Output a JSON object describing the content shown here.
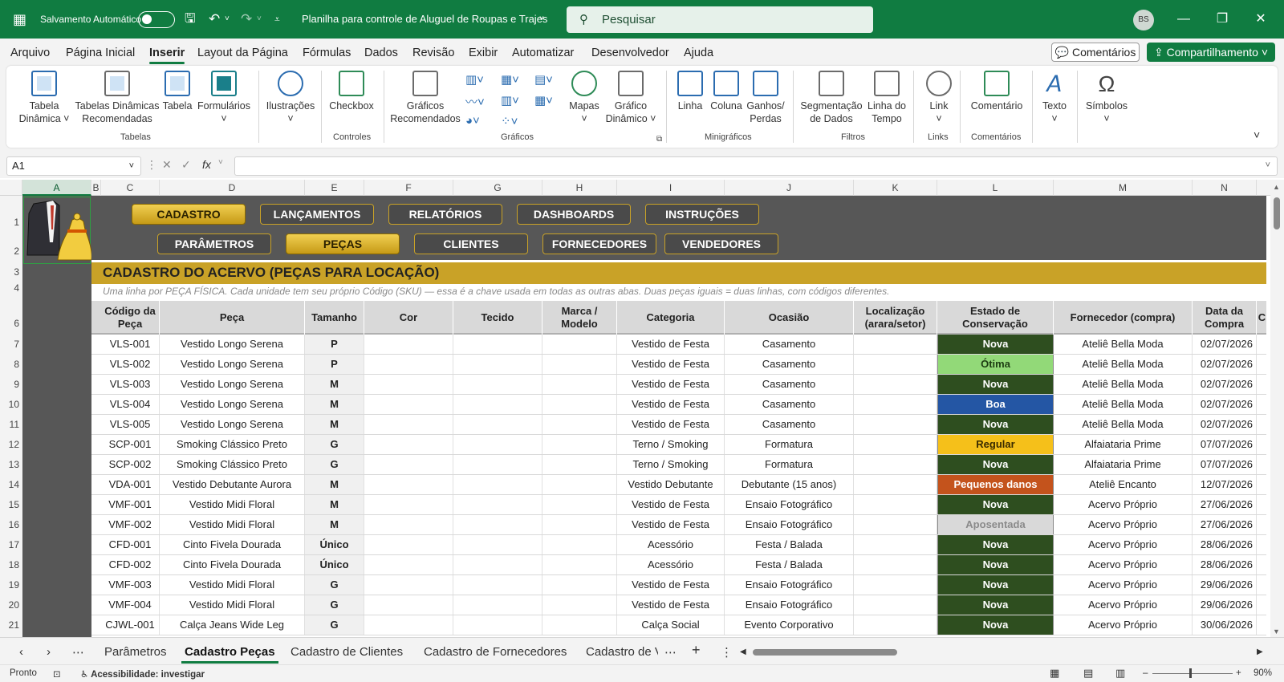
{
  "titlebar": {
    "autosave_label": "Salvamento Automático",
    "doc_title": "Planilha para controle de Aluguel de Roupas e Trajes",
    "search_placeholder": "Pesquisar",
    "user_initials": "BS"
  },
  "menu": {
    "items": [
      "Arquivo",
      "Página Inicial",
      "Inserir",
      "Layout da Página",
      "Fórmulas",
      "Dados",
      "Revisão",
      "Exibir",
      "Automatizar",
      "Desenvolvedor",
      "Ajuda"
    ],
    "active": "Inserir",
    "comments_label": "Comentários",
    "share_label": "Compartilhamento"
  },
  "ribbon": {
    "buttons": [
      {
        "label1": "Tabela",
        "label2": "Dinâmica ˅"
      },
      {
        "label1": "Tabelas Dinâmicas",
        "label2": "Recomendadas"
      },
      {
        "label1": "Tabela",
        "label2": ""
      },
      {
        "label1": "Formulários",
        "label2": "˅"
      },
      {
        "label1": "Ilustrações",
        "label2": "˅"
      },
      {
        "label1": "Checkbox",
        "label2": ""
      },
      {
        "label1": "Gráficos",
        "label2": "Recomendados"
      },
      {
        "label1": "Mapas",
        "label2": "˅"
      },
      {
        "label1": "Gráfico",
        "label2": "Dinâmico ˅"
      },
      {
        "label1": "Linha",
        "label2": ""
      },
      {
        "label1": "Coluna",
        "label2": ""
      },
      {
        "label1": "Ganhos/",
        "label2": "Perdas"
      },
      {
        "label1": "Segmentação",
        "label2": "de Dados"
      },
      {
        "label1": "Linha do",
        "label2": "Tempo"
      },
      {
        "label1": "Link",
        "label2": "˅"
      },
      {
        "label1": "Comentário",
        "label2": ""
      },
      {
        "label1": "Texto",
        "label2": "˅"
      },
      {
        "label1": "Símbolos",
        "label2": "˅"
      }
    ],
    "groups": [
      "Tabelas",
      "Controles",
      "Gráficos",
      "Minigráficos",
      "Filtros",
      "Links",
      "Comentários"
    ]
  },
  "formula_bar": {
    "cell_ref": "A1",
    "fx": "fx"
  },
  "columns": [
    "A",
    "B",
    "C",
    "D",
    "E",
    "F",
    "G",
    "H",
    "I",
    "J",
    "K",
    "L",
    "M",
    "N"
  ],
  "row_numbers": [
    "1",
    "2",
    "3",
    "4",
    "6",
    "7",
    "8",
    "9",
    "10",
    "11",
    "12",
    "13",
    "14",
    "15",
    "16",
    "17",
    "18",
    "19",
    "20",
    "21"
  ],
  "nav": {
    "row1": [
      "CADASTRO",
      "LANÇAMENTOS",
      "RELATÓRIOS",
      "DASHBOARDS",
      "INSTRUÇÕES"
    ],
    "row2": [
      "PARÂMETROS",
      "PEÇAS",
      "CLIENTES",
      "FORNECEDORES",
      "VENDEDORES"
    ]
  },
  "sheet": {
    "banner": "CADASTRO DO ACERVO (PEÇAS PARA LOCAÇÃO)",
    "subtitle": "Uma linha por PEÇA FÍSICA. Cada unidade tem seu próprio Código (SKU) — essa é a chave usada em todas as outras abas. Duas peças iguais = duas linhas, com códigos diferentes.",
    "headers": [
      "Código da Peça",
      "Peça",
      "Tamanho",
      "Cor",
      "Tecido",
      "Marca / Modelo",
      "Categoria",
      "Ocasião",
      "Localização (arara/setor)",
      "Estado de Conservação",
      "Fornecedor (compra)",
      "Data da Compra",
      "C"
    ],
    "rows": [
      [
        "VLS-001",
        "Vestido Longo Serena",
        "P",
        "",
        "",
        "",
        "Vestido de Festa",
        "Casamento",
        "",
        "Nova",
        "Ateliê Bella Moda",
        "02/07/2026"
      ],
      [
        "VLS-002",
        "Vestido Longo Serena",
        "P",
        "",
        "",
        "",
        "Vestido de Festa",
        "Casamento",
        "",
        "Ótima",
        "Ateliê Bella Moda",
        "02/07/2026"
      ],
      [
        "VLS-003",
        "Vestido Longo Serena",
        "M",
        "",
        "",
        "",
        "Vestido de Festa",
        "Casamento",
        "",
        "Nova",
        "Ateliê Bella Moda",
        "02/07/2026"
      ],
      [
        "VLS-004",
        "Vestido Longo Serena",
        "M",
        "",
        "",
        "",
        "Vestido de Festa",
        "Casamento",
        "",
        "Boa",
        "Ateliê Bella Moda",
        "02/07/2026"
      ],
      [
        "VLS-005",
        "Vestido Longo Serena",
        "M",
        "",
        "",
        "",
        "Vestido de Festa",
        "Casamento",
        "",
        "Nova",
        "Ateliê Bella Moda",
        "02/07/2026"
      ],
      [
        "SCP-001",
        "Smoking Clássico Preto",
        "G",
        "",
        "",
        "",
        "Terno / Smoking",
        "Formatura",
        "",
        "Regular",
        "Alfaiataria Prime",
        "07/07/2026"
      ],
      [
        "SCP-002",
        "Smoking Clássico Preto",
        "G",
        "",
        "",
        "",
        "Terno / Smoking",
        "Formatura",
        "",
        "Nova",
        "Alfaiataria Prime",
        "07/07/2026"
      ],
      [
        "VDA-001",
        "Vestido Debutante Aurora",
        "M",
        "",
        "",
        "",
        "Vestido Debutante",
        "Debutante (15 anos)",
        "",
        "Pequenos danos",
        "Ateliê Encanto",
        "12/07/2026"
      ],
      [
        "VMF-001",
        "Vestido Midi Floral",
        "M",
        "",
        "",
        "",
        "Vestido de Festa",
        "Ensaio Fotográfico",
        "",
        "Nova",
        "Acervo Próprio",
        "27/06/2026"
      ],
      [
        "VMF-002",
        "Vestido Midi Floral",
        "M",
        "",
        "",
        "",
        "Vestido de Festa",
        "Ensaio Fotográfico",
        "",
        "Aposentada",
        "Acervo Próprio",
        "27/06/2026"
      ],
      [
        "CFD-001",
        "Cinto Fivela Dourada",
        "Único",
        "",
        "",
        "",
        "Acessório",
        "Festa / Balada",
        "",
        "Nova",
        "Acervo Próprio",
        "28/06/2026"
      ],
      [
        "CFD-002",
        "Cinto Fivela Dourada",
        "Único",
        "",
        "",
        "",
        "Acessório",
        "Festa / Balada",
        "",
        "Nova",
        "Acervo Próprio",
        "28/06/2026"
      ],
      [
        "VMF-003",
        "Vestido Midi Floral",
        "G",
        "",
        "",
        "",
        "Vestido de Festa",
        "Ensaio Fotográfico",
        "",
        "Nova",
        "Acervo Próprio",
        "29/06/2026"
      ],
      [
        "VMF-004",
        "Vestido Midi Floral",
        "G",
        "",
        "",
        "",
        "Vestido de Festa",
        "Ensaio Fotográfico",
        "",
        "Nova",
        "Acervo Próprio",
        "29/06/2026"
      ],
      [
        "CJWL-001",
        "Calça Jeans Wide Leg",
        "G",
        "",
        "",
        "",
        "Calça Social",
        "Evento Corporativo",
        "",
        "Nova",
        "Acervo Próprio",
        "30/06/2026"
      ]
    ],
    "status_colors": {
      "Nova": {
        "bg": "#2e4e1f",
        "fg": "#ffffff"
      },
      "Ótima": {
        "bg": "#92d978",
        "fg": "#1d3d12"
      },
      "Boa": {
        "bg": "#2456a4",
        "fg": "#ffffff"
      },
      "Regular": {
        "bg": "#f5c01a",
        "fg": "#3a2b00"
      },
      "Pequenos danos": {
        "bg": "#c4531c",
        "fg": "#ffffff"
      },
      "Aposentada": {
        "bg": "#d9d9d9",
        "fg": "#8a8a8a"
      }
    }
  },
  "tabs": [
    "Parâmetros",
    "Cadastro Peças",
    "Cadastro de Clientes",
    "Cadastro de Fornecedores",
    "Cadastro de V"
  ],
  "active_tab": "Cadastro Peças",
  "status": {
    "ready": "Pronto",
    "accessibility": "Acessibilidade: investigar",
    "zoom": "90%"
  },
  "colors": {
    "excel_green": "#107c41",
    "gold": "#c9a227",
    "dark_panel": "#575757"
  }
}
